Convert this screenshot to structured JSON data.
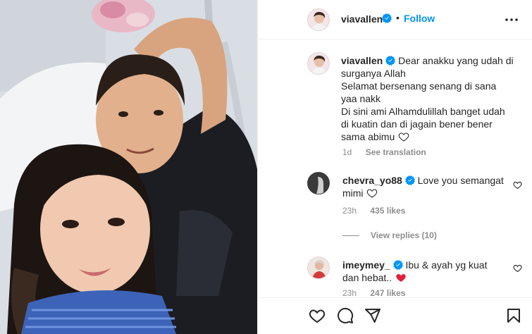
{
  "header": {
    "username": "viavallen",
    "separator": "•",
    "follow_label": "Follow"
  },
  "caption": {
    "username": "viavallen",
    "lines": [
      "Dear anakku yang udah di",
      "surganya Allah",
      "Selamat bersenang senang di sana",
      "yaa nakk",
      "Di sini ami Alhamdulillah banget udah",
      "di kuatin dan di jagain bener bener",
      "sama abimu"
    ],
    "time": "1d",
    "see_translation": "See translation"
  },
  "comments": [
    {
      "username": "chevra_yo88",
      "text_line1": "Love you semangat",
      "text_line2": "mimi",
      "time": "23h",
      "likes": "435 likes"
    },
    {
      "username": "imeymey_",
      "text_line1": "Ibu & ayah yg kuat",
      "text_line2": "dan hebat..",
      "time": "23h",
      "likes": "247 likes"
    }
  ],
  "view_replies": "View replies (10)",
  "icons": {
    "verified": "verified-badge-icon",
    "more": "more-options-icon",
    "like": "heart-icon",
    "comment": "comment-bubble-icon",
    "share": "paper-plane-icon",
    "save": "bookmark-icon"
  },
  "colors": {
    "accent": "#0095f6",
    "text": "#262626",
    "secondary": "#8e8e8e",
    "heart_red": "#ed4956"
  }
}
